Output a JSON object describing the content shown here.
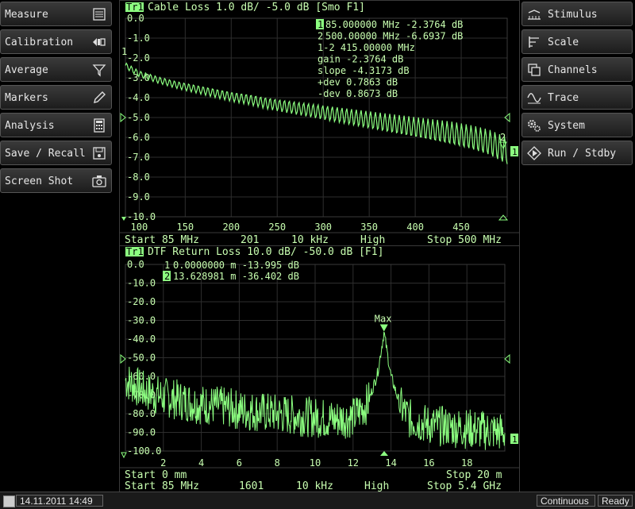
{
  "left_menu": [
    {
      "label": "Measure",
      "icon": "list-icon"
    },
    {
      "label": "Calibration",
      "icon": "calibration-icon"
    },
    {
      "label": "Average",
      "icon": "filter-icon"
    },
    {
      "label": "Markers",
      "icon": "pen-icon"
    },
    {
      "label": "Analysis",
      "icon": "calculator-icon"
    },
    {
      "label": "Save / Recall",
      "icon": "save-icon"
    },
    {
      "label": "Screen Shot",
      "icon": "camera-icon"
    }
  ],
  "right_menu": [
    {
      "label": "Stimulus",
      "icon": "stimulus-icon"
    },
    {
      "label": "Scale",
      "icon": "scale-icon"
    },
    {
      "label": "Channels",
      "icon": "channels-icon"
    },
    {
      "label": "Trace",
      "icon": "trace-icon"
    },
    {
      "label": "System",
      "icon": "gears-icon"
    },
    {
      "label": "Run / Stdby",
      "icon": "run-icon"
    }
  ],
  "colors": {
    "trace": "#8cff80",
    "text": "#c8ffb0",
    "grid": "#2e2e2e",
    "marker_fill": "#8cff80"
  },
  "chart1": {
    "trace_tag": "Tr1",
    "title": "Cable Loss 1.0 dB/ -5.0 dB [Smo F1]",
    "y_ticks": [
      "0.0",
      "-1.0",
      "-2.0",
      "-3.0",
      "-4.0",
      "-5.0",
      "-6.0",
      "-7.0",
      "-8.0",
      "-9.0",
      "-10.0"
    ],
    "x_ticks": [
      "100",
      "150",
      "200",
      "250",
      "300",
      "350",
      "400",
      "450"
    ],
    "footer": {
      "start": "Start 85 MHz",
      "points": "201",
      "ifbw": "10 kHz",
      "power": "High",
      "stop": "Stop 500 MHz"
    },
    "marker_rows": [
      {
        "id": "1",
        "text": "  85.000000 MHz -2.3764 dB"
      },
      {
        "id": "2",
        "text": " 500.00000 MHz -6.6937 dB"
      },
      {
        "id": "",
        "text": "1-2     415.00000  MHz"
      },
      {
        "id": "",
        "text": "gain    -2.3764 dB"
      },
      {
        "id": "",
        "text": "slope   -4.3173 dB"
      },
      {
        "id": "",
        "text": "+dev     0.7863 dB"
      },
      {
        "id": "",
        "text": "-dev     0.8673 dB"
      }
    ],
    "trace_end_tag": "1",
    "marker2_label": "2"
  },
  "chart2": {
    "trace_tag": "Tr1",
    "title": "DTF Return Loss 10.0 dB/ -50.0 dB [F1]",
    "y_ticks": [
      "0.0",
      "-10.0",
      "-20.0",
      "-30.0",
      "-40.0",
      "-50.0",
      "-60.0",
      "-70.0",
      "-80.0",
      "-90.0",
      "-100.0"
    ],
    "x_ticks": [
      "2",
      "4",
      "6",
      "8",
      "10",
      "12",
      "14",
      "16",
      "18"
    ],
    "footer1": {
      "start": "Start 0 mm",
      "stop": "Stop 20 m"
    },
    "footer2": {
      "start": "Start 85 MHz",
      "points": "1601",
      "ifbw": "10 kHz",
      "power": "High",
      "stop": "Stop 5.4 GHz"
    },
    "marker_rows": [
      {
        "id": "1",
        "text": "  0.0000000 m -13.995 dB"
      },
      {
        "id": "2",
        "text": "  13.628981 m -36.402 dB"
      }
    ],
    "max_label": "Max",
    "trace_end_tag": "1"
  },
  "status": {
    "datetime": "14.11.2011 14:49",
    "mode": "Continuous",
    "state": "Ready"
  },
  "chart_data": [
    {
      "type": "line",
      "title": "Cable Loss 1.0 dB/ -5.0 dB [Smo F1]",
      "xlabel": "",
      "ylabel": "",
      "xlim": [
        85,
        500
      ],
      "ylim": [
        -10,
        0
      ],
      "x": [
        85,
        100,
        120,
        140,
        160,
        180,
        200,
        220,
        240,
        260,
        280,
        300,
        320,
        340,
        360,
        380,
        400,
        420,
        440,
        460,
        480,
        500
      ],
      "series": [
        {
          "values": [
            -2.38,
            -2.8,
            -3.1,
            -3.35,
            -3.55,
            -3.75,
            -3.95,
            -4.1,
            -4.3,
            -4.45,
            -4.6,
            -4.75,
            -4.9,
            -5.05,
            -5.2,
            -5.35,
            -5.5,
            -5.65,
            -5.8,
            -6.0,
            -6.25,
            -6.69
          ]
        }
      ],
      "ripple_db": [
        0.3,
        1.4
      ]
    },
    {
      "type": "line",
      "title": "DTF Return Loss 10.0 dB/ -50.0 dB [F1]",
      "xlabel": "",
      "ylabel": "",
      "xlim": [
        0,
        20
      ],
      "ylim": [
        -100,
        0
      ],
      "x": [
        0,
        1,
        2,
        3,
        4,
        5,
        6,
        7,
        8,
        9,
        10,
        11,
        12,
        12.8,
        13.3,
        13.63,
        14.0,
        14.5,
        15,
        16,
        17,
        18,
        19,
        20
      ],
      "series": [
        {
          "values": [
            -62,
            -68,
            -71,
            -73,
            -75,
            -76,
            -78,
            -79,
            -80,
            -81,
            -82,
            -83,
            -82,
            -74,
            -58,
            -36.4,
            -60,
            -76,
            -83,
            -86,
            -87,
            -88,
            -89,
            -90
          ]
        }
      ]
    }
  ]
}
